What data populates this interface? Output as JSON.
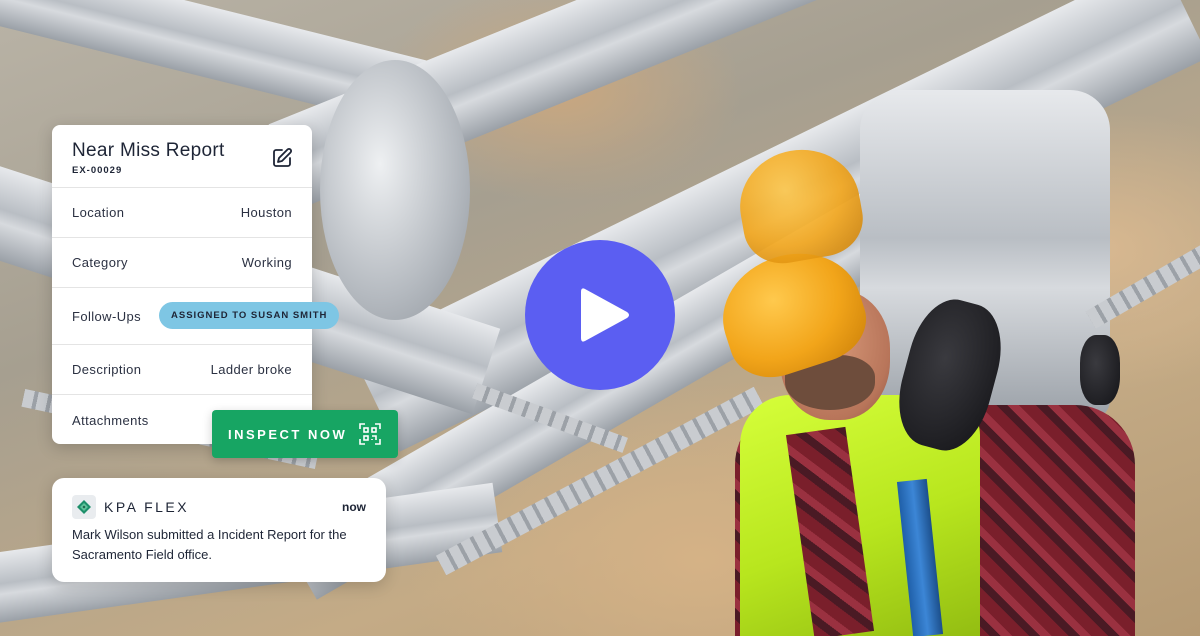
{
  "report": {
    "title": "Near Miss Report",
    "id": "EX-00029",
    "fields": [
      {
        "label": "Location",
        "value": "Houston"
      },
      {
        "label": "Category",
        "value": "Working"
      },
      {
        "label": "Follow-Ups",
        "value": "ASSIGNED TO SUSAN SMITH"
      },
      {
        "label": "Description",
        "value": "Ladder broke"
      },
      {
        "label": "Attachments",
        "value": ""
      }
    ]
  },
  "inspect_button": {
    "label": "INSPECT NOW",
    "icon": "qr-scan-icon"
  },
  "video": {
    "icon": "play-icon",
    "color": "#5b5ef2"
  },
  "notification": {
    "app": "KPA FLEX",
    "time": "now",
    "message": "Mark Wilson submitted a Incident Report for the Sacramento Field office."
  },
  "colors": {
    "accent_green": "#17a563",
    "pill_blue": "#7ec6e4",
    "play_purple": "#5b5ef2"
  }
}
